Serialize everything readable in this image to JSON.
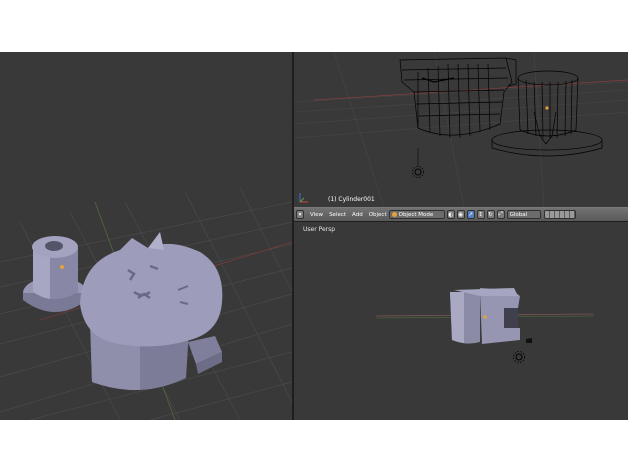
{
  "viewport_top_right": {
    "object_label": "(1) Cylinder001"
  },
  "viewport_bottom_right": {
    "view_label": "User Persp"
  },
  "header": {
    "menus": [
      "View",
      "Select",
      "Add",
      "Object"
    ],
    "mode": "Object Mode",
    "pivot": "Global"
  },
  "colors": {
    "background": "#393939",
    "accent": "#5680c2",
    "origin": "#e8a03a"
  }
}
